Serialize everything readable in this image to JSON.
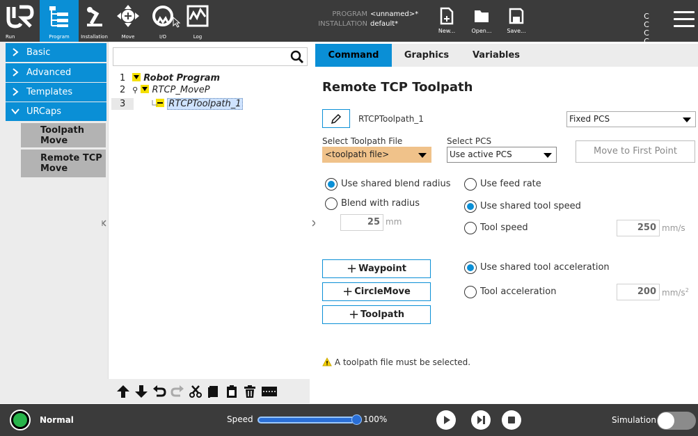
{
  "topbar": {
    "nav": [
      {
        "label": "Run"
      },
      {
        "label": "Program"
      },
      {
        "label": "Installation"
      },
      {
        "label": "Move"
      },
      {
        "label": "I/O"
      },
      {
        "label": "Log"
      }
    ],
    "program_label": "PROGRAM",
    "program_value": "<unnamed>*",
    "installation_label": "INSTALLATION",
    "installation_value": "default*",
    "file_buttons": [
      {
        "label": "New..."
      },
      {
        "label": "Open..."
      },
      {
        "label": "Save..."
      }
    ],
    "cc_text": "C C C C"
  },
  "leftnav": {
    "categories": [
      {
        "label": "Basic"
      },
      {
        "label": "Advanced"
      },
      {
        "label": "Templates"
      },
      {
        "label": "URCaps"
      }
    ],
    "urcaps_items": [
      {
        "line1": "Toolpath",
        "line2": "Move"
      },
      {
        "line1": "Remote TCP",
        "line2": "Move"
      }
    ]
  },
  "tree": {
    "search_placeholder": "",
    "lines": [
      {
        "num": "1",
        "text": "Robot Program"
      },
      {
        "num": "2",
        "text": "RTCP_MoveP"
      },
      {
        "num": "3",
        "text": "RTCPToolpath_1"
      }
    ]
  },
  "tabs": [
    {
      "label": "Command"
    },
    {
      "label": "Graphics"
    },
    {
      "label": "Variables"
    }
  ],
  "command": {
    "title": "Remote TCP Toolpath",
    "node_name": "RTCPToolpath_1",
    "pcs_mode": "Fixed PCS",
    "select_toolpath_label": "Select Toolpath File",
    "toolpath_value": "<toolpath file>",
    "select_pcs_label": "Select PCS",
    "pcs_value": "Use active PCS",
    "move_first_point": "Move to First Point",
    "radios_left": [
      {
        "label": "Use shared blend radius",
        "selected": true
      },
      {
        "label": "Blend with radius",
        "selected": false
      }
    ],
    "blend_radius_value": "25",
    "blend_radius_unit": "mm",
    "radios_speed": [
      {
        "label": "Use feed rate",
        "selected": false
      },
      {
        "label": "Use shared tool speed",
        "selected": true
      },
      {
        "label": "Tool speed",
        "selected": false
      }
    ],
    "tool_speed_value": "250",
    "tool_speed_unit": "mm/s",
    "radios_accel": [
      {
        "label": "Use shared tool acceleration",
        "selected": true
      },
      {
        "label": "Tool acceleration",
        "selected": false
      }
    ],
    "tool_accel_value": "200",
    "tool_accel_unit": "mm/s",
    "tool_accel_unit_sup": "2",
    "add_buttons": [
      {
        "label": "Waypoint"
      },
      {
        "label": "CircleMove"
      },
      {
        "label": "Toolpath"
      }
    ],
    "warning_text": "A toolpath file must be selected."
  },
  "bottombar": {
    "status": "Normal",
    "speed_label": "Speed",
    "speed_percent": "100%",
    "speed_fraction": 1.0,
    "simulation_label": "Simulation",
    "simulation_on": false
  },
  "colors": {
    "accent": "#0a8fd6",
    "topbar": "#3b3b3b",
    "status_ok": "#27b34a",
    "warning_fill": "#f0c28a",
    "tree_marker": "#f5e000"
  }
}
